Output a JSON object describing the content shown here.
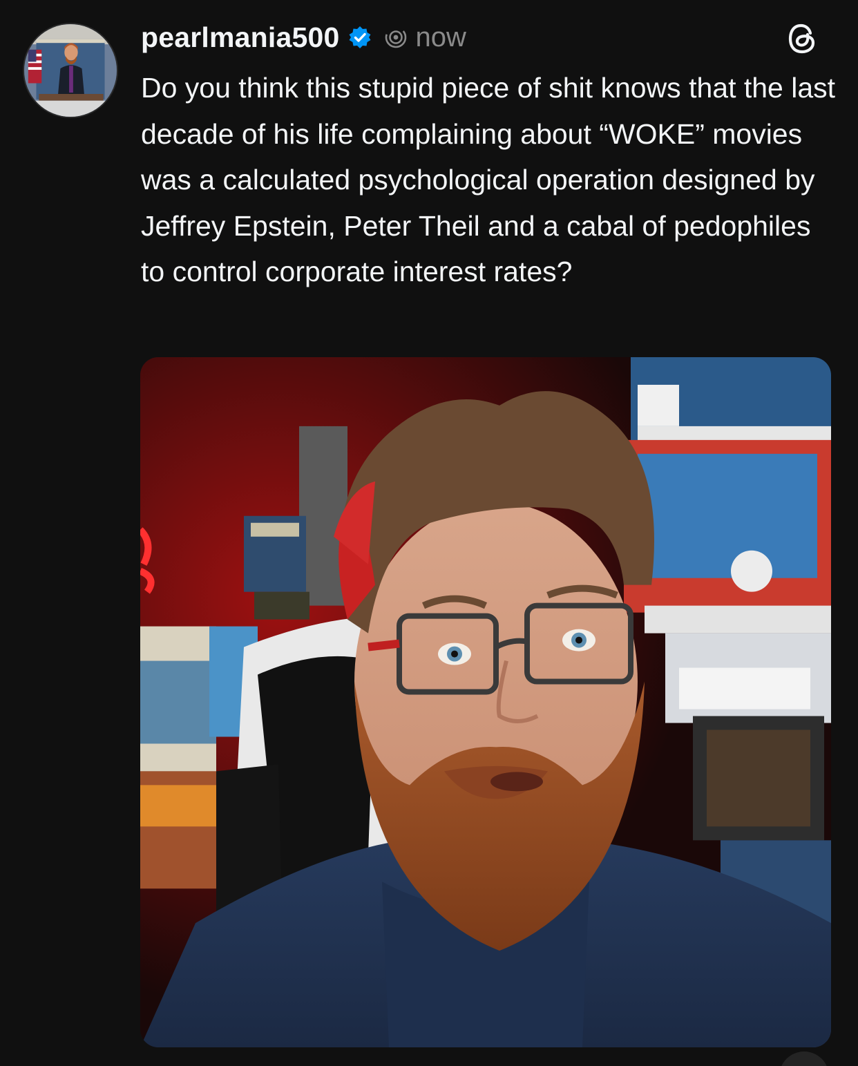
{
  "post": {
    "username": "pearlmania500",
    "timestamp": "now",
    "text": "Do you think this stupid piece of shit knows that the last decade of his life complaining about “WOKE” movies was a calculated psychological operation designed by Jeffrey Epstein, Peter Theil and a cabal of pedophiles to control corporate interest rates?",
    "verified": true,
    "media_type": "photo"
  },
  "icons": {
    "verified": "verified-badge-icon",
    "threads_mark": "threads-glyph-icon",
    "threads_logo": "threads-logo-icon"
  },
  "colors": {
    "background": "#101010",
    "text": "#f3f5f7",
    "muted": "#8a8a8a",
    "verified": "#0095f6"
  }
}
